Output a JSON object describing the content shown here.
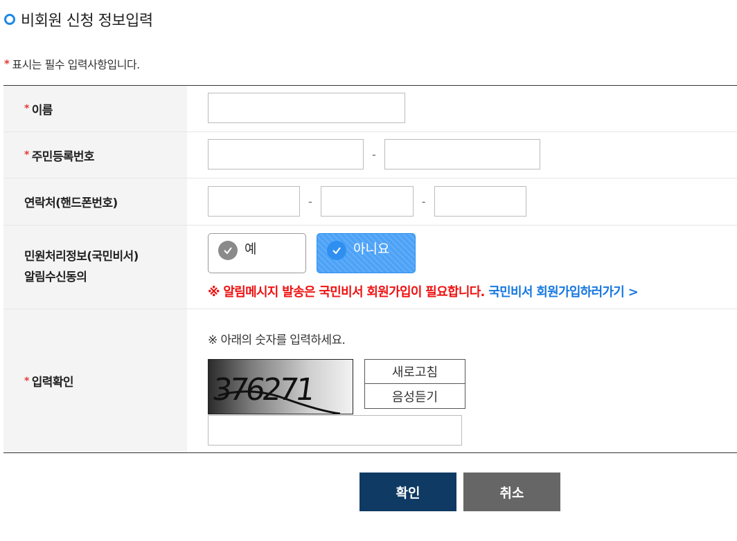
{
  "section_title": "비회원 신청 정보입력",
  "required_notice": "표시는 필수 입력사항입니다.",
  "required_mark": "*",
  "fields": {
    "name": {
      "label": "이름"
    },
    "resident_number": {
      "label": "주민등록번호",
      "separator": "-"
    },
    "phone": {
      "label": "연락처(핸드폰번호)",
      "separator": "-"
    },
    "consent": {
      "label_line1": "민원처리정보(국민비서)",
      "label_line2": "알림수신동의",
      "options": [
        "예",
        "아니요"
      ],
      "selected": "아니요",
      "warning_red": "※ 알림메시지 발송은 국민비서 회원가입이 필요합니다.",
      "warning_link": "국민비서 회원가입하러가기 >"
    },
    "captcha": {
      "label": "입력확인",
      "instruction": "※ 아래의 숫자를 입력하세요.",
      "image_text": "376271",
      "refresh_label": "새로고침",
      "audio_label": "음성듣기"
    }
  },
  "buttons": {
    "confirm": "확인",
    "cancel": "취소"
  },
  "colors": {
    "accent": "#1e88e5",
    "required": "#e53935",
    "primary_button": "#0f3a63",
    "secondary_button": "#666666",
    "warning": "#e11111",
    "link": "#1577e0"
  }
}
